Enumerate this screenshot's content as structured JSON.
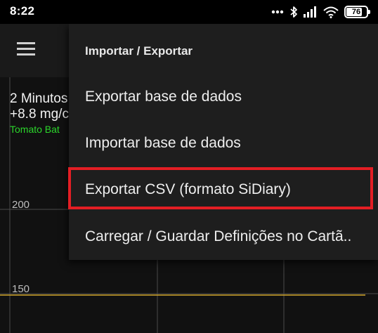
{
  "status_bar": {
    "time": "8:22",
    "battery_level": "76",
    "icons": [
      "more-dots-icon",
      "bluetooth-icon",
      "signal-icon",
      "wifi-icon",
      "battery-icon"
    ]
  },
  "app_bar": {
    "menu_icon": "hamburger-menu-icon"
  },
  "info_panel": {
    "line1": "2 Minutos",
    "line2": "+8.8 mg/c",
    "line3": "Tomato Bat"
  },
  "chart_data": {
    "type": "line",
    "y_tick_labels": [
      "200",
      "150"
    ],
    "grid": true,
    "target_line_value": 150,
    "colors": {
      "grid": "#4a4a4a",
      "target_line": "#d4a72c"
    }
  },
  "menu": {
    "title": "Importar / Exportar",
    "items": [
      {
        "label": "Exportar base de dados"
      },
      {
        "label": "Importar base de dados"
      },
      {
        "label": "Exportar CSV (formato SiDiary)"
      },
      {
        "label": "Carregar / Guardar Definições no Cartã.."
      }
    ]
  },
  "colors": {
    "highlight": "#e31e24",
    "popup_background": "#1e1e1e",
    "status_green": "#2bd62b"
  }
}
